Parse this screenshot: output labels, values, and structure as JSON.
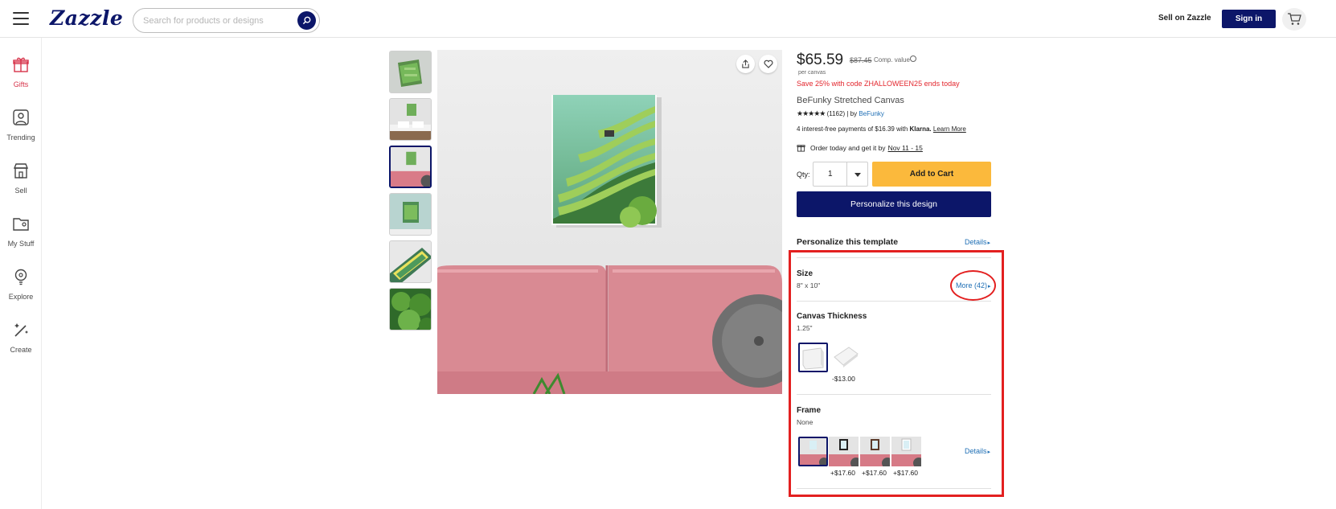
{
  "header": {
    "logo": "Zazzle",
    "search_placeholder": "Search for products or designs",
    "sell_label": "Sell on Zazzle",
    "signin_label": "Sign in"
  },
  "rail": {
    "items": [
      {
        "label": "Gifts"
      },
      {
        "label": "Trending"
      },
      {
        "label": "Sell"
      },
      {
        "label": "My Stuff"
      },
      {
        "label": "Explore"
      },
      {
        "label": "Create"
      }
    ]
  },
  "product": {
    "price": "$65.59",
    "original_price": "$87.45",
    "comp_label": "Comp. value",
    "per_unit": "per canvas",
    "promo": "Save 25% with code ZHALLOWEEN25 ends today",
    "name": "BeFunky Stretched Canvas",
    "stars": "★★★★★",
    "reviews": "(1162) | by",
    "brand": "BeFunky",
    "klarna_text": "4 interest-free payments of $16.39 with",
    "klarna_brand": "Klarna.",
    "klarna_learn": "Learn More",
    "delivery_text": "Order today and get it by",
    "delivery_date": "Nov 11 - 15",
    "qty_label": "Qty:",
    "qty_value": "1",
    "add_to_cart": "Add to Cart",
    "personalize_design": "Personalize this design"
  },
  "options": {
    "template_title": "Personalize this template",
    "details": "Details",
    "size_title": "Size",
    "size_value": "8\" x 10\"",
    "size_more": "More (42)",
    "thickness_title": "Canvas Thickness",
    "thickness_value": "1.25\"",
    "thickness_alt_price": "-$13.00",
    "frame_title": "Frame",
    "frame_value": "None",
    "frame_prices": [
      "+$17.60",
      "+$17.60",
      "+$17.60"
    ],
    "frame_details": "Details"
  },
  "colors": {
    "brand_navy": "#0c1669",
    "cart_yellow": "#fbb93c",
    "promo_red": "#e3262d",
    "link_blue": "#1f6fb5",
    "annotation_red": "#e32020"
  }
}
